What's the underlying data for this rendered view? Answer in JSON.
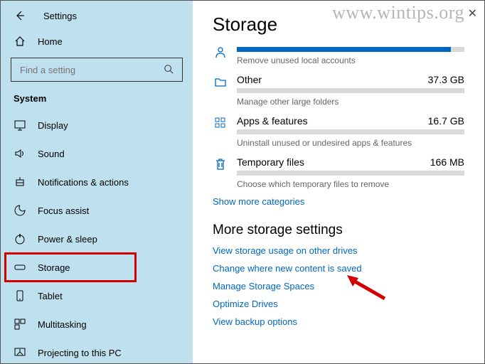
{
  "window": {
    "title": "Settings",
    "close_glyph": "✕"
  },
  "watermark": "www.wintips.org",
  "sidebar": {
    "search_placeholder": "Find a setting",
    "home_label": "Home",
    "section_label": "System",
    "items": [
      {
        "label": "Display"
      },
      {
        "label": "Sound"
      },
      {
        "label": "Notifications & actions"
      },
      {
        "label": "Focus assist"
      },
      {
        "label": "Power & sleep"
      },
      {
        "label": "Storage"
      },
      {
        "label": "Tablet"
      },
      {
        "label": "Multitasking"
      },
      {
        "label": "Projecting to this PC"
      }
    ],
    "selected_index": 5
  },
  "storage": {
    "heading": "Storage",
    "categories": [
      {
        "icon": "user",
        "name": "",
        "size": "",
        "fill_pct": 94,
        "sub": "Remove unused local accounts"
      },
      {
        "icon": "folder",
        "name": "Other",
        "size": "37.3 GB",
        "fill_pct": 0,
        "sub": "Manage other large folders"
      },
      {
        "icon": "apps",
        "name": "Apps & features",
        "size": "16.7 GB",
        "fill_pct": 0,
        "sub": "Uninstall unused or undesired apps & features"
      },
      {
        "icon": "trash",
        "name": "Temporary files",
        "size": "166 MB",
        "fill_pct": 0,
        "sub": "Choose which temporary files to remove"
      }
    ],
    "show_more": "Show more categories",
    "more_heading": "More storage settings",
    "links": [
      "View storage usage on other drives",
      "Change where new content is saved",
      "Manage Storage Spaces",
      "Optimize Drives",
      "View backup options"
    ]
  }
}
